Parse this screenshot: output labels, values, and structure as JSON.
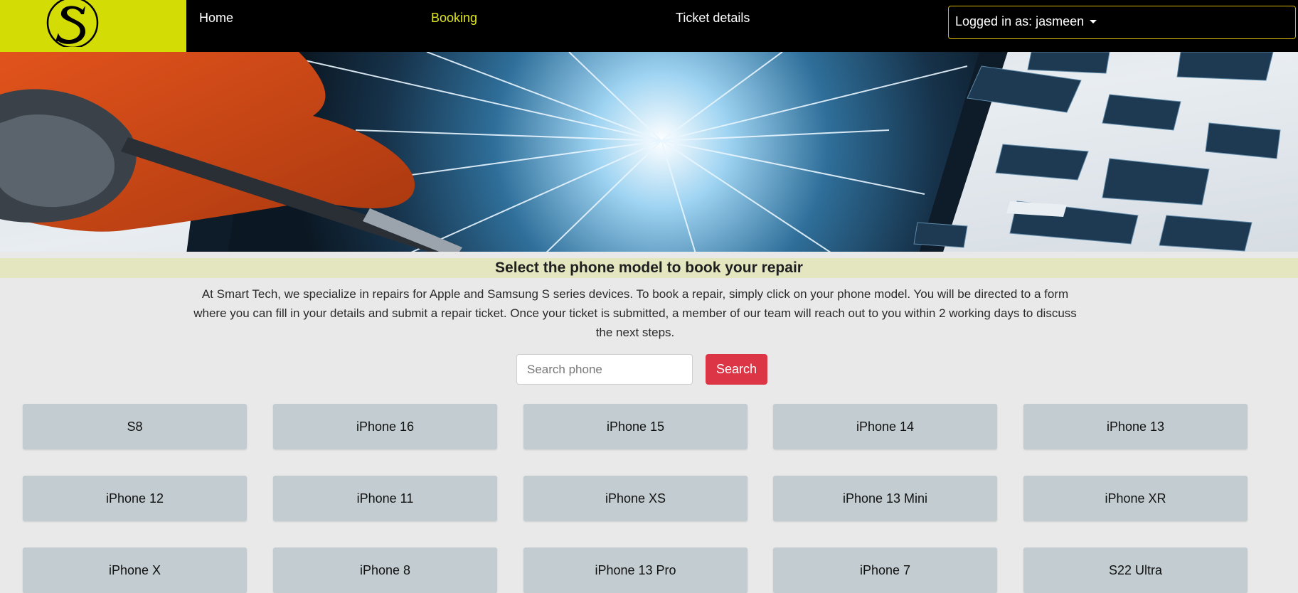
{
  "nav": {
    "home": "Home",
    "booking": "Booking",
    "ticket_details": "Ticket details",
    "user": "Logged in as: jasmeen",
    "active_color": "#e0e61e",
    "logo_color": "#d4dc06"
  },
  "main": {
    "heading": "Select the phone model to book your repair",
    "intro": "At Smart Tech, we specialize in repairs for Apple and Samsung S series devices. To book a repair, simply click on your phone model. You will be directed to a form where you can fill in your details and submit a repair ticket. Once your ticket is submitted, a member of our team will reach out to you within 2 working days to discuss the next steps."
  },
  "search": {
    "placeholder": "Search phone",
    "button": "Search",
    "button_color": "#dc3545"
  },
  "phones": [
    "S8",
    "iPhone 16",
    "iPhone 15",
    "iPhone 14",
    "iPhone 13",
    "iPhone 12",
    "iPhone 11",
    "iPhone XS",
    "iPhone 13 Mini",
    "iPhone XR",
    "iPhone X",
    "iPhone 8",
    "iPhone 13 Pro",
    "iPhone 7",
    "S22 Ultra"
  ]
}
